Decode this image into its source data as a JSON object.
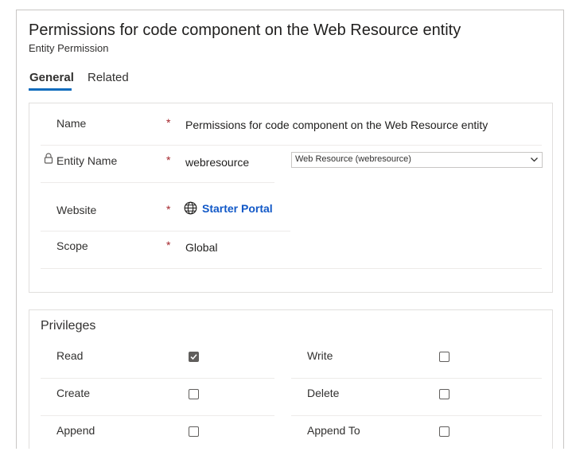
{
  "header": {
    "title": "Permissions for code component on the Web Resource entity",
    "subtitle": "Entity Permission"
  },
  "tabs": [
    {
      "label": "General",
      "selected": true
    },
    {
      "label": "Related",
      "selected": false
    }
  ],
  "general": {
    "required_marker": "*",
    "name": {
      "label": "Name",
      "value": "Permissions for code component on the Web Resource entity"
    },
    "entity_name": {
      "label": "Entity Name",
      "value": "webresource",
      "select_value": "Web Resource (webresource)",
      "locked": true
    },
    "website": {
      "label": "Website",
      "value": "Starter Portal"
    },
    "scope": {
      "label": "Scope",
      "value": "Global"
    }
  },
  "privileges": {
    "title": "Privileges",
    "items": [
      {
        "label": "Read",
        "checked": true
      },
      {
        "label": "Write",
        "checked": false
      },
      {
        "label": "Create",
        "checked": false
      },
      {
        "label": "Delete",
        "checked": false
      },
      {
        "label": "Append",
        "checked": false
      },
      {
        "label": "Append To",
        "checked": false
      }
    ]
  },
  "colors": {
    "accent": "#0f6cbd",
    "link": "#1158c7",
    "required": "#a4262c"
  }
}
